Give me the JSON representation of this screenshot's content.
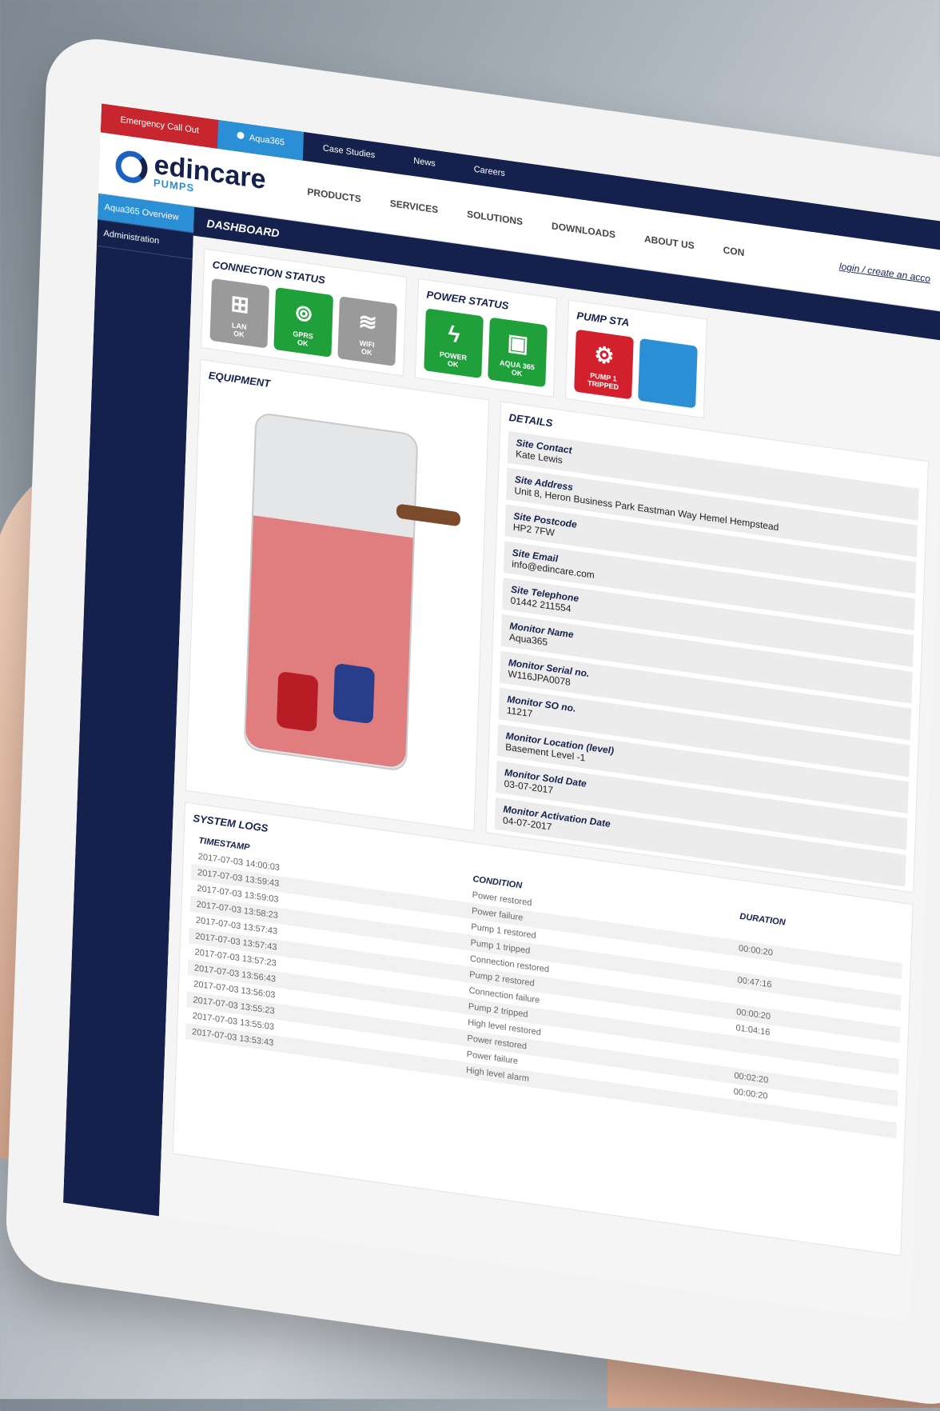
{
  "topbar": {
    "emergency": "Emergency Call Out",
    "aqua": "Aqua365",
    "links": [
      "Case Studies",
      "News",
      "Careers"
    ]
  },
  "header": {
    "logo_main": "edincare",
    "logo_sub": "PUMPS",
    "nav": [
      "PRODUCTS",
      "SERVICES",
      "SOLUTIONS",
      "DOWNLOADS",
      "ABOUT US",
      "CON"
    ],
    "login": "login / create an acco"
  },
  "sidebar": {
    "items": [
      "Aqua365 Overview",
      "Administration"
    ]
  },
  "dashboard_title": "DASHBOARD",
  "connection": {
    "title": "CONNECTION STATUS",
    "tiles": [
      {
        "label": "LAN\nOK",
        "color": "#9a9a9a",
        "icon": "lan-icon"
      },
      {
        "label": "GPRS\nOK",
        "color": "#1fa03a",
        "icon": "gprs-icon"
      },
      {
        "label": "WIFI\nOK",
        "color": "#9a9a9a",
        "icon": "wifi-icon"
      }
    ]
  },
  "power": {
    "title": "POWER STATUS",
    "tiles": [
      {
        "label": "POWER\nOK",
        "color": "#1fa03a",
        "icon": "lightning-icon"
      },
      {
        "label": "AQUA 365\nOK",
        "color": "#1fa03a",
        "icon": "lightning-box-icon"
      }
    ]
  },
  "pump": {
    "title": "PUMP STA",
    "tiles": [
      {
        "label": "PUMP 1\nTRIPPED",
        "color": "#d2202d",
        "icon": "pump-icon"
      }
    ]
  },
  "equipment": {
    "title": "EQUIPMENT"
  },
  "details": {
    "title": "DETAILS",
    "rows": [
      {
        "label": "Site Contact",
        "value": "Kate Lewis"
      },
      {
        "label": "Site Address",
        "value": "Unit 8, Heron Business Park Eastman Way Hemel Hempstead"
      },
      {
        "label": "Site Postcode",
        "value": "HP2 7FW"
      },
      {
        "label": "Site Email",
        "value": "info@edincare.com"
      },
      {
        "label": "Site Telephone",
        "value": "01442 211554"
      },
      {
        "label": "Monitor Name",
        "value": "Aqua365"
      },
      {
        "label": "Monitor Serial no.",
        "value": "W116JPA0078"
      },
      {
        "label": "Monitor SO no.",
        "value": "11217"
      },
      {
        "label": "Monitor Location (level)",
        "value": "Basement Level -1"
      },
      {
        "label": "Monitor Sold Date",
        "value": "03-07-2017"
      },
      {
        "label": "Monitor Activation Date",
        "value": "04-07-2017"
      }
    ]
  },
  "logs": {
    "title": "SYSTEM LOGS",
    "headers": [
      "TIMESTAMP",
      "CONDITION",
      "DURATION"
    ],
    "rows": [
      {
        "ts": "2017-07-03 14:00:03",
        "cond": "Power restored",
        "ok": true,
        "dur": ""
      },
      {
        "ts": "2017-07-03 13:59:43",
        "cond": "Power failure",
        "ok": false,
        "dur": "00:00:20"
      },
      {
        "ts": "2017-07-03 13:59:03",
        "cond": "Pump 1 restored",
        "ok": true,
        "dur": ""
      },
      {
        "ts": "2017-07-03 13:58:23",
        "cond": "Pump 1 tripped",
        "ok": false,
        "dur": "00:47:16"
      },
      {
        "ts": "2017-07-03 13:57:43",
        "cond": "Connection restored",
        "ok": true,
        "dur": ""
      },
      {
        "ts": "2017-07-03 13:57:43",
        "cond": "Pump 2 restored",
        "ok": true,
        "dur": "00:00:20"
      },
      {
        "ts": "2017-07-03 13:57:23",
        "cond": "Connection failure",
        "ok": false,
        "dur": "01:04:16"
      },
      {
        "ts": "2017-07-03 13:56:43",
        "cond": "Pump 2 tripped",
        "ok": false,
        "dur": ""
      },
      {
        "ts": "2017-07-03 13:56:03",
        "cond": "High level restored",
        "ok": true,
        "dur": ""
      },
      {
        "ts": "2017-07-03 13:55:23",
        "cond": "Power restored",
        "ok": true,
        "dur": "00:02:20"
      },
      {
        "ts": "2017-07-03 13:55:03",
        "cond": "Power failure",
        "ok": false,
        "dur": "00:00:20"
      },
      {
        "ts": "2017-07-03 13:53:43",
        "cond": "High level alarm",
        "ok": false,
        "dur": ""
      }
    ]
  }
}
